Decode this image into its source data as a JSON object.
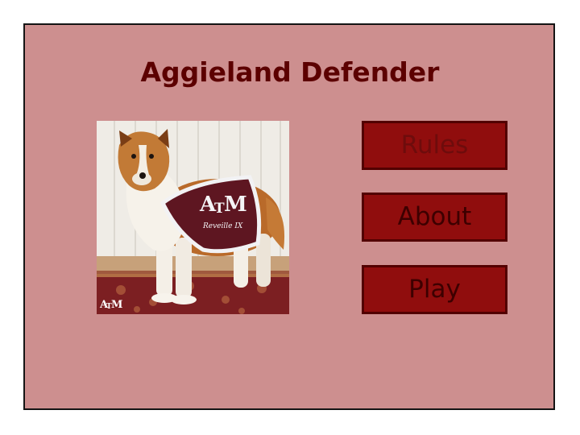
{
  "game": {
    "title": "Aggieland Defender",
    "menu": {
      "rules_label": "Rules",
      "about_label": "About",
      "play_label": "Play"
    },
    "mascot_image": {
      "blanket_logo": "ATM",
      "blanket_name": "Reveille IX",
      "corner_logo": "ATM"
    }
  },
  "colors": {
    "frame_bg": "#cd8f8f",
    "title_text": "#5c0000",
    "button_bg": "#900d0d",
    "button_border": "#520000"
  },
  "icons": {
    "mascot": "collie-dog-photo",
    "logo": "atm-logo"
  }
}
